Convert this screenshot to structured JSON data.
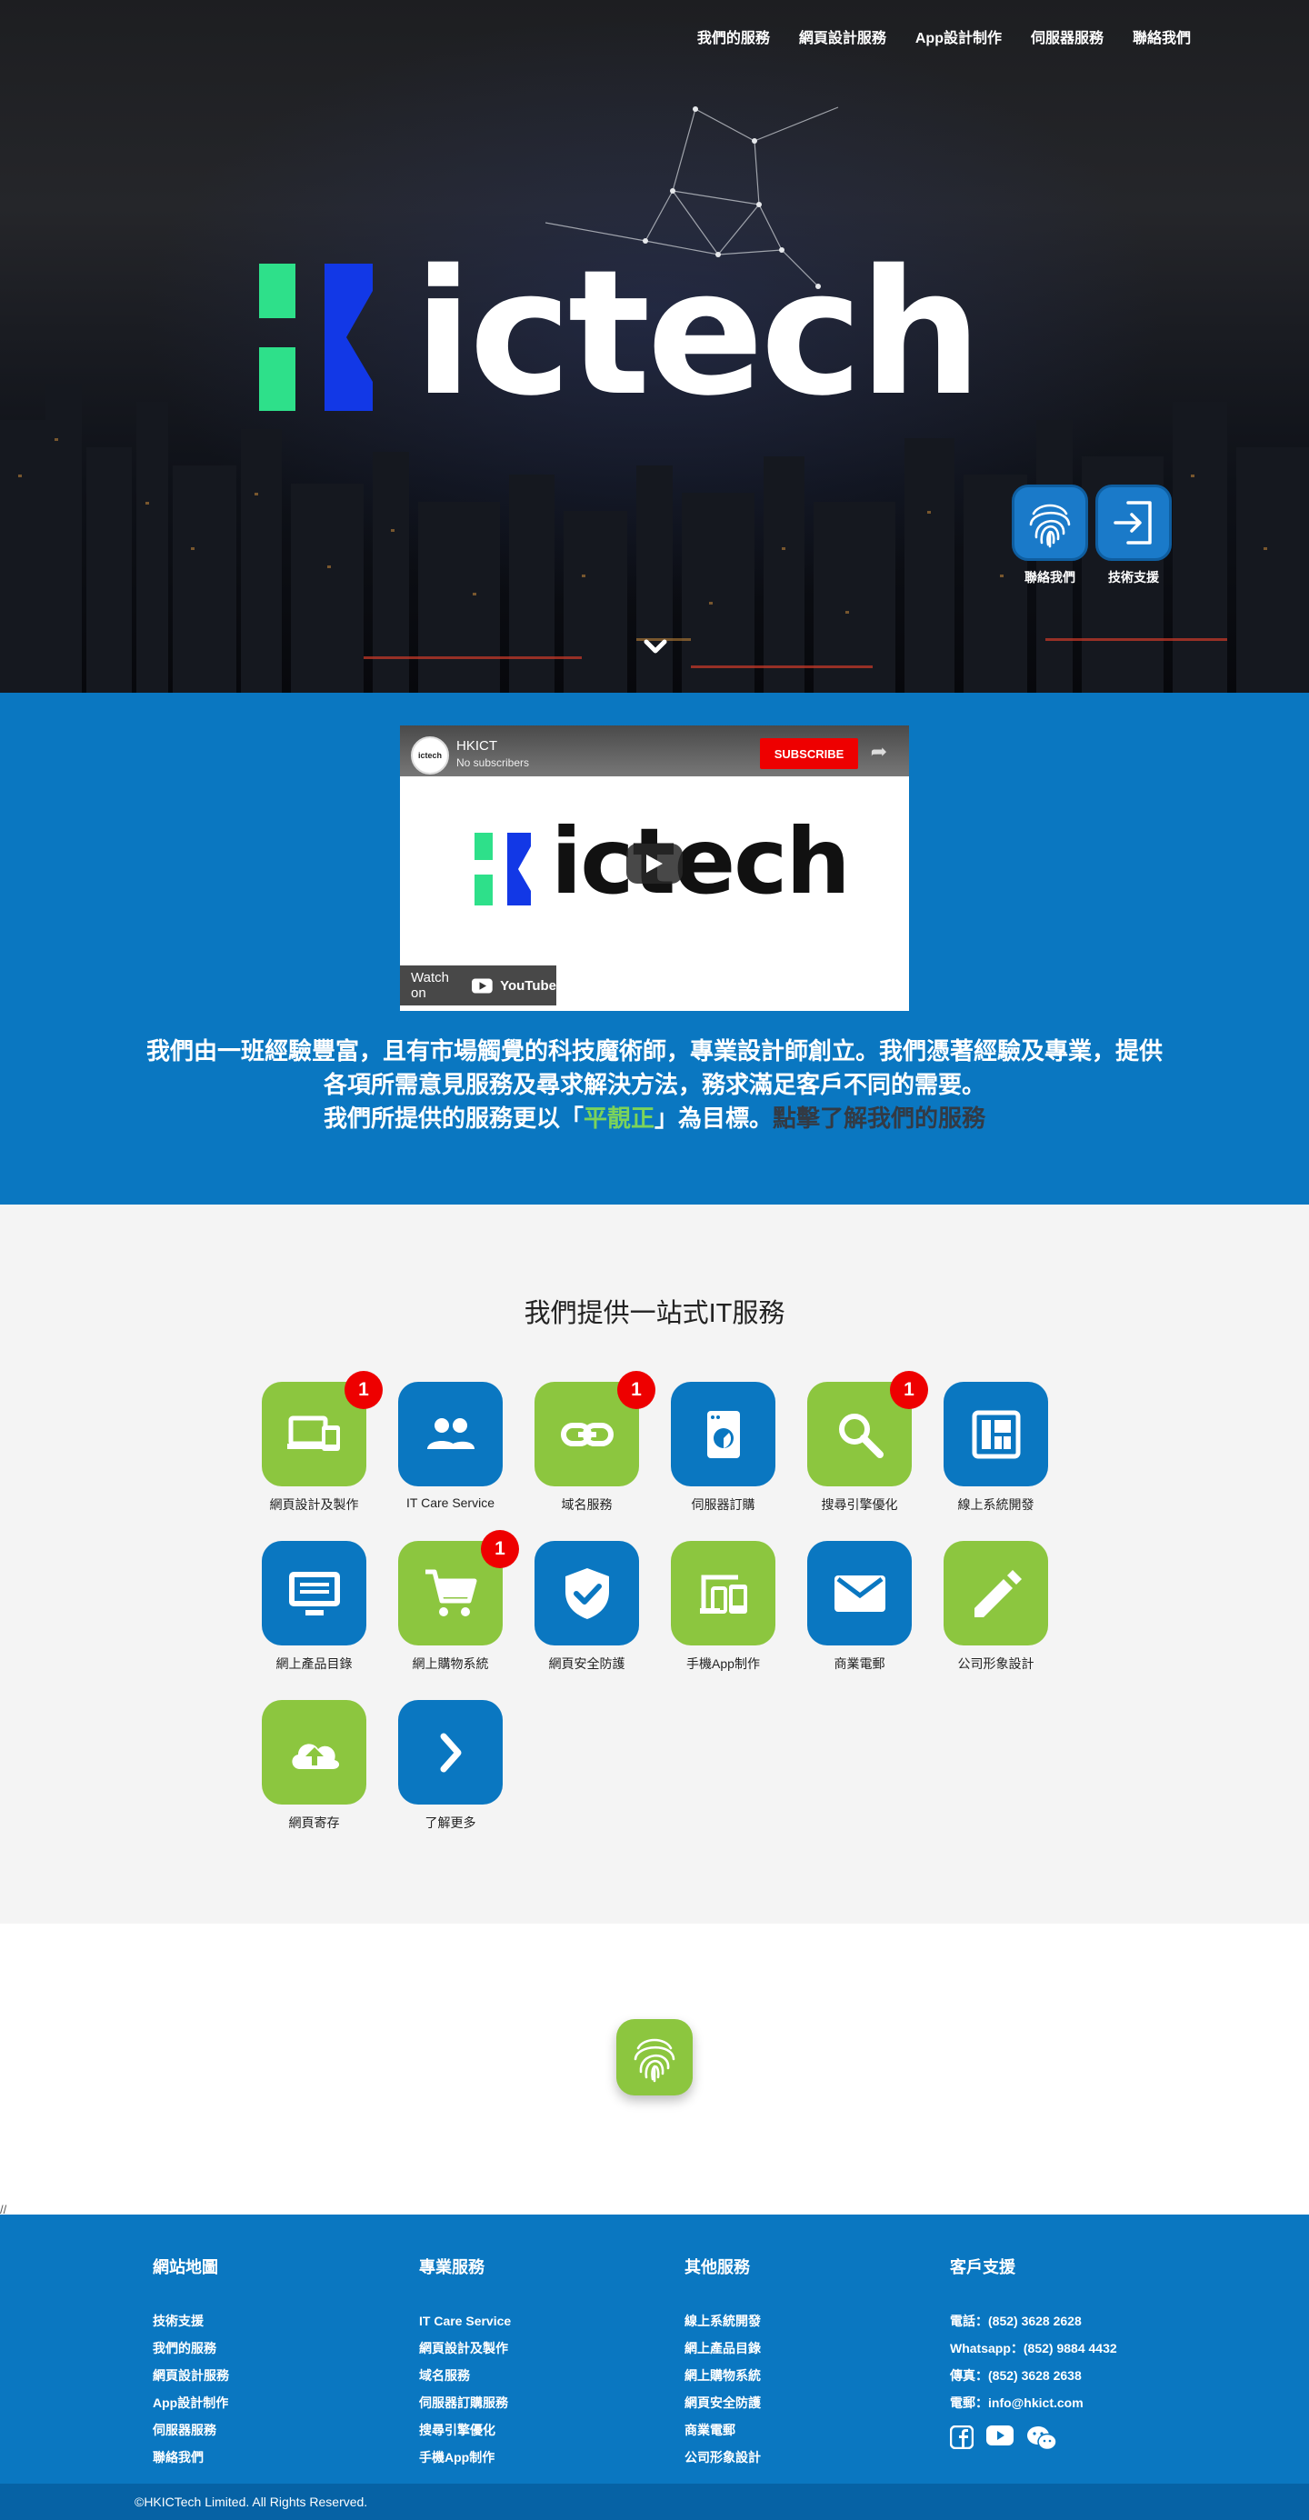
{
  "nav": [
    "我們的服務",
    "網頁設計服務",
    "App設計制作",
    "伺服器服務",
    "聯絡我們"
  ],
  "hero": {
    "brand": "ictech",
    "float_buttons": [
      {
        "label": "聯絡我們",
        "icon": "fingerprint-icon"
      },
      {
        "label": "技術支援",
        "icon": "login-icon"
      }
    ]
  },
  "video": {
    "channel_name": "HKICT",
    "channel_subs": "No subscribers",
    "avatar_text": "ictech",
    "subscribe_label": "SUBSCRIBE",
    "brand": "ictech",
    "watch_on": "Watch on",
    "youtube": "YouTube"
  },
  "intro": {
    "line1": "我們由一班經驗豐富，且有市場觸覺的科技魔術師，專業設計師創立。我們憑著經驗及專業，提供",
    "line2": "各項所需意見服務及尋求解決方法，務求滿足客戶不同的需要。",
    "line3_pre": "我們所提供的服務更以「",
    "line3_accent": "平靚正",
    "line3_post": "」為目標。",
    "line3_link": "點擊了解我們的服務"
  },
  "services": {
    "title": "我們提供一站式IT服務",
    "items": [
      {
        "name": "網頁設計及製作",
        "color": "green",
        "badge": "1",
        "icon": "devices-icon"
      },
      {
        "name": "IT Care Service",
        "color": "blue",
        "badge": "",
        "icon": "people-icon"
      },
      {
        "name": "域名服務",
        "color": "green",
        "badge": "1",
        "icon": "link-icon"
      },
      {
        "name": "伺服器訂購",
        "color": "blue",
        "badge": "",
        "icon": "server-icon"
      },
      {
        "name": "搜尋引擎優化",
        "color": "green",
        "badge": "1",
        "icon": "search-icon"
      },
      {
        "name": "線上系統開發",
        "color": "blue",
        "badge": "",
        "icon": "dashboard-icon"
      },
      {
        "name": "網上產品目錄",
        "color": "blue",
        "badge": "",
        "icon": "monitor-icon"
      },
      {
        "name": "網上購物系統",
        "color": "green",
        "badge": "1",
        "icon": "cart-icon"
      },
      {
        "name": "網頁安全防護",
        "color": "blue",
        "badge": "",
        "icon": "shield-check-icon"
      },
      {
        "name": "手機App制作",
        "color": "green",
        "badge": "",
        "icon": "mobile-devices-icon"
      },
      {
        "name": "商業電郵",
        "color": "blue",
        "badge": "",
        "icon": "mail-icon"
      },
      {
        "name": "公司形象設計",
        "color": "green",
        "badge": "",
        "icon": "pencil-icon"
      },
      {
        "name": "網頁寄存",
        "color": "green",
        "badge": "",
        "icon": "cloud-upload-icon"
      },
      {
        "name": "了解更多",
        "color": "blue",
        "badge": "",
        "icon": "chevron-right-icon"
      }
    ]
  },
  "slashes": "//",
  "footer": {
    "sitemap": {
      "title": "網站地圖",
      "items": [
        "技術支援",
        "我們的服務",
        "網頁設計服務",
        "App設計制作",
        "伺服器服務",
        "聯絡我們"
      ]
    },
    "pro": {
      "title": "專業服務",
      "items": [
        "IT Care Service",
        "網頁設計及製作",
        "域名服務",
        "伺服器訂購服務",
        "搜尋引擎優化",
        "手機App制作"
      ]
    },
    "other": {
      "title": "其他服務",
      "items": [
        "線上系統開發",
        "網上產品目錄",
        "網上購物系統",
        "網頁安全防護",
        "商業電郵",
        "公司形象設計"
      ]
    },
    "support": {
      "title": "客戶支援",
      "items": [
        "電話：(852) 3628 2628",
        "Whatsapp：(852) 9884 4432",
        "傳真：(852) 3628 2638",
        "電郵：info@hkict.com"
      ]
    },
    "copyright": "©HKICTech Limited. All Rights Reserved."
  },
  "colors": {
    "primary_blue": "#0a77c1",
    "green": "#8cc63f",
    "badge_red": "#e00000",
    "logo_green": "#2ee08a",
    "logo_blue": "#1238e6"
  }
}
